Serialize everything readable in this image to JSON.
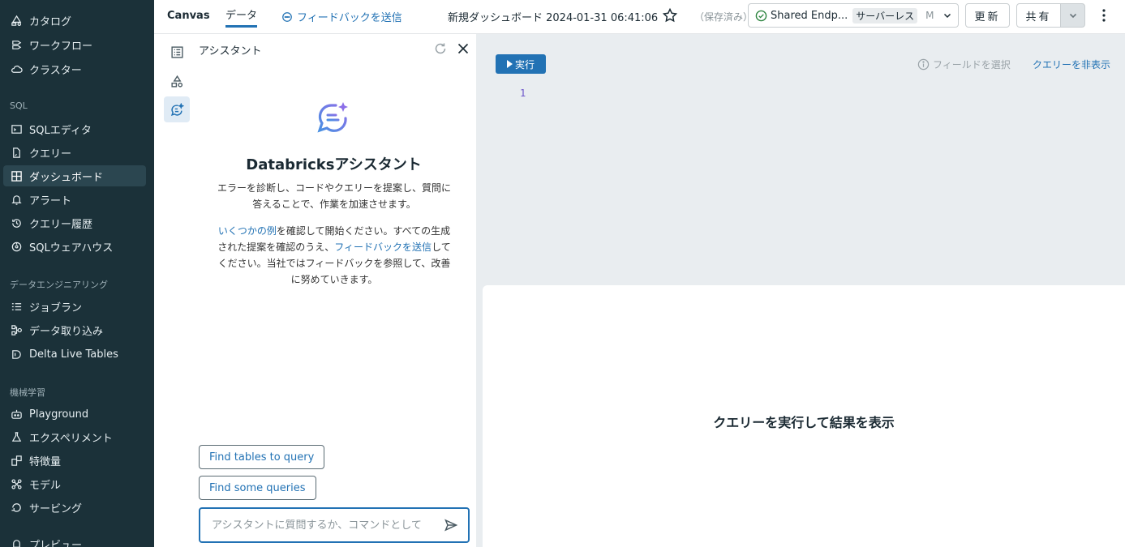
{
  "sidebar": {
    "items": [
      {
        "label": "カタログ",
        "icon": "catalog-icon"
      },
      {
        "label": "ワークフロー",
        "icon": "workflow-icon"
      },
      {
        "label": "クラスター",
        "icon": "cloud-icon"
      },
      {
        "label": "SQLエディタ",
        "icon": "sql-editor-icon"
      },
      {
        "label": "クエリー",
        "icon": "query-icon"
      },
      {
        "label": "ダッシュボード",
        "icon": "dashboard-icon"
      },
      {
        "label": "アラート",
        "icon": "bell-icon"
      },
      {
        "label": "クエリー履歴",
        "icon": "history-icon"
      },
      {
        "label": "SQLウェアハウス",
        "icon": "warehouse-icon"
      },
      {
        "label": "ジョブラン",
        "icon": "job-runs-icon"
      },
      {
        "label": "データ取り込み",
        "icon": "data-ingest-icon"
      },
      {
        "label": "Delta Live Tables",
        "icon": "delta-icon"
      },
      {
        "label": "Playground",
        "icon": "robot-icon"
      },
      {
        "label": "エクスペリメント",
        "icon": "flask-icon"
      },
      {
        "label": "特徴量",
        "icon": "feature-store-icon"
      },
      {
        "label": "モデル",
        "icon": "model-icon"
      },
      {
        "label": "サービング",
        "icon": "serving-icon"
      },
      {
        "label": "プレビュー",
        "icon": "preview-icon"
      }
    ],
    "sections": {
      "sql": "SQL",
      "data_engineering": "データエンジニアリング",
      "ml": "機械学習"
    }
  },
  "topbar": {
    "tab_canvas": "Canvas",
    "tab_data": "データ",
    "feedback": "フィードバックを送信",
    "dashboard_title": "新規ダッシュボード 2024-01-31 06:41:06",
    "saved_status": "（保存済み）",
    "endpoint_name": "Shared Endp...",
    "endpoint_type": "サーバーレス",
    "endpoint_size": "M",
    "refresh_label": "更新",
    "share_label": "共有"
  },
  "assistant": {
    "title": "アシスタント",
    "heading": "Databricksアシスタント",
    "description": "エラーを診断し、コードやクエリーを提案し、質問に答えることで、作業を加速させます。",
    "examples_link": "いくつかの例",
    "text_a": "を確認して開始ください。すべての生成された提案を確認のうえ、",
    "feedback_link": "フィードバックを送信",
    "text_b": "してください。当社ではフィードバックを参照して、改善に努めていきます。",
    "suggestions": [
      "Find tables to query",
      "Find some queries"
    ],
    "input_placeholder": "アシスタントに質問するか、コマンドとして"
  },
  "editor": {
    "run_label": "実行",
    "field_select": "フィールドを選択",
    "hide_query": "クエリーを非表示",
    "line_number": "1"
  },
  "results": {
    "message": "クエリーを実行して結果を表示"
  },
  "colors": {
    "sidebar_bg": "#1b3139",
    "accent": "#2272b4",
    "editor_bg": "#e9edf0"
  }
}
